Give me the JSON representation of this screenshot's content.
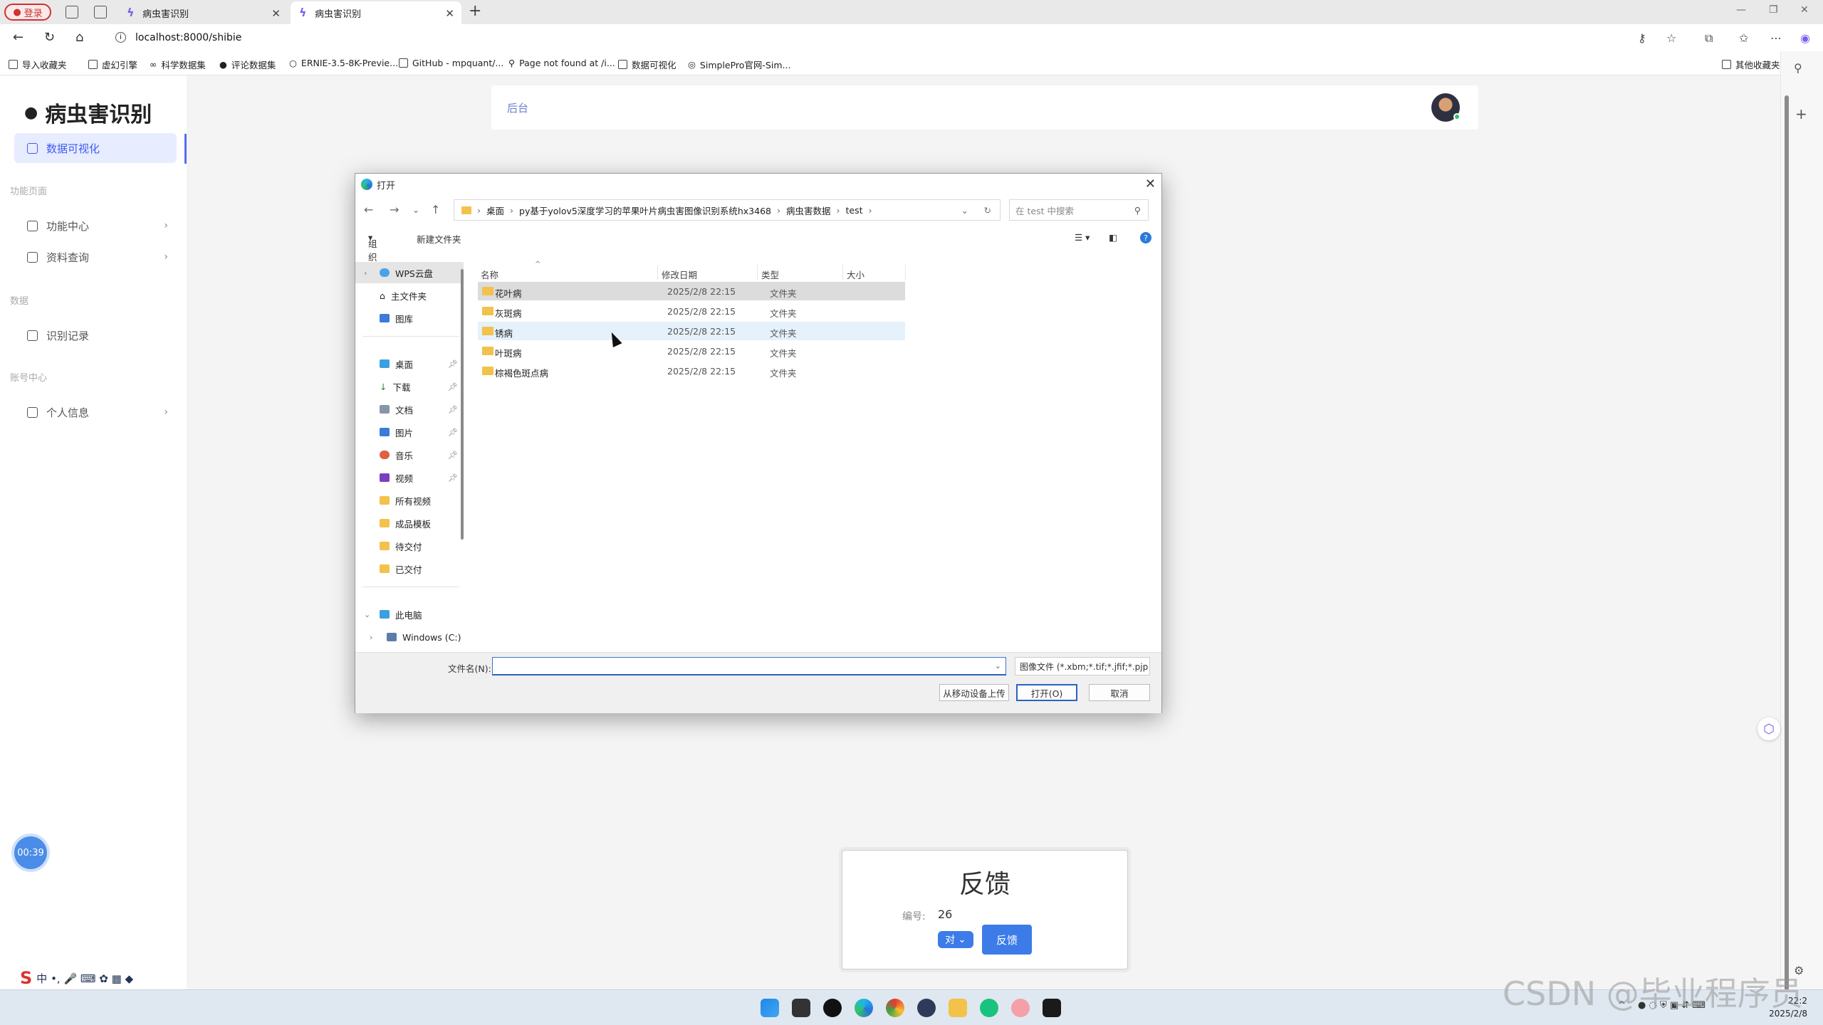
{
  "browser": {
    "profile_label": "登录",
    "tabs": [
      {
        "title": "病虫害识别"
      },
      {
        "title": "病虫害识别"
      }
    ],
    "url": "localhost:8000/shibie",
    "bookmarks": [
      {
        "label": "导入收藏夹"
      },
      {
        "label": "虚幻引擎"
      },
      {
        "label": "科学数据集"
      },
      {
        "label": "评论数据集"
      },
      {
        "label": "ERNIE-3.5-8K-Previe..."
      },
      {
        "label": "GitHub - mpquant/..."
      },
      {
        "label": "Page not found at /i..."
      },
      {
        "label": "数据可视化"
      },
      {
        "label": "SimplePro官网-Sim..."
      }
    ],
    "other_bookmarks": "其他收藏夹"
  },
  "sidebar": {
    "brand": "病虫害识别",
    "active_item": "数据可视化",
    "group_function": "功能页面",
    "item_function_center": "功能中心",
    "item_docs": "资料查询",
    "group_data": "数据",
    "item_records": "识别记录",
    "group_account": "账号中心",
    "item_profile": "个人信息"
  },
  "header": {
    "breadcrumb": "后台"
  },
  "timer": "00:39",
  "feedback": {
    "title": "反馈",
    "id_label": "编号:",
    "id_value": "26",
    "select_value": "对",
    "button": "反馈"
  },
  "dialog": {
    "title": "打开",
    "path": [
      "桌面",
      "py基于yolov5深度学习的苹果叶片病虫害图像识别系统hx3468",
      "病虫害数据",
      "test"
    ],
    "search_placeholder": "在 test 中搜索",
    "organize": "组织",
    "new_folder": "新建文件夹",
    "nav": {
      "wps": "WPS云盘",
      "home": "主文件夹",
      "gallery": "图库",
      "desktop": "桌面",
      "downloads": "下载",
      "documents": "文档",
      "pictures": "图片",
      "music": "音乐",
      "videos": "视频",
      "all_videos": "所有视频",
      "templates": "成品模板",
      "to_deliver": "待交付",
      "delivered": "已交付",
      "this_pc": "此电脑",
      "windows_c": "Windows (C:)"
    },
    "columns": {
      "name": "名称",
      "date": "修改日期",
      "type": "类型",
      "size": "大小"
    },
    "files": [
      {
        "name": "花叶病",
        "date": "2025/2/8 22:15",
        "type": "文件夹"
      },
      {
        "name": "灰斑病",
        "date": "2025/2/8 22:15",
        "type": "文件夹"
      },
      {
        "name": "锈病",
        "date": "2025/2/8 22:15",
        "type": "文件夹"
      },
      {
        "name": "叶斑病",
        "date": "2025/2/8 22:15",
        "type": "文件夹"
      },
      {
        "name": "棕褐色斑点病",
        "date": "2025/2/8 22:15",
        "type": "文件夹"
      }
    ],
    "filename_label": "文件名(N):",
    "filename_value": "",
    "filetype": "图像文件 (*.xbm;*.tif;*.jfif;*.pjp",
    "btn_mobile": "从移动设备上传",
    "btn_open": "打开(O)",
    "btn_cancel": "取消"
  },
  "taskbar": {
    "clock_time": "22:2",
    "clock_date": "2025/2/8"
  },
  "watermark": "CSDN @毕业程序员"
}
